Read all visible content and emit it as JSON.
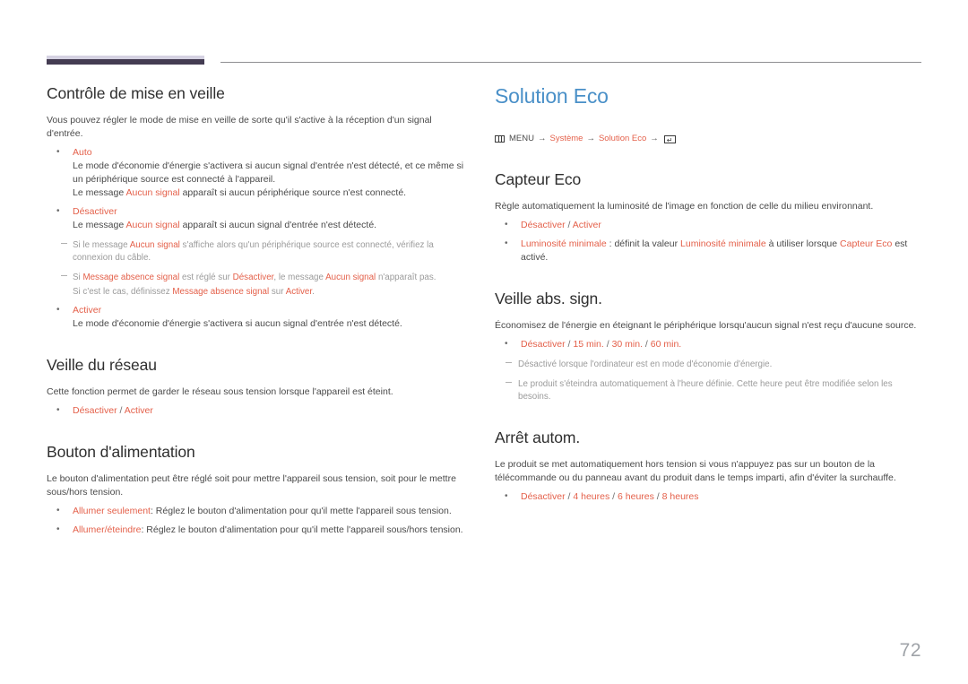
{
  "document": {
    "page_number": "72",
    "accent_color": "#e4604a",
    "title_color": "#4a90c8",
    "rule_color": "#443c52"
  },
  "left_column": {
    "section1": {
      "heading": "Contrôle de mise en veille",
      "intro": "Vous pouvez régler le mode de mise en veille de sorte qu'il s'active à la réception d'un signal d'entrée.",
      "items": [
        {
          "label": "Auto",
          "line1": "Le mode d'économie d'énergie s'activera si aucun signal d'entrée n'est détecté, et ce même si un périphérique source est connecté à l'appareil.",
          "line2_pre": "Le message ",
          "line2_accent": "Aucun signal",
          "line2_post": " apparaît si aucun périphérique source n'est connecté."
        },
        {
          "label": "Désactiver",
          "line1_pre": "Le message ",
          "line1_accent": "Aucun signal",
          "line1_post": " apparaît si aucun signal d'entrée n'est détecté."
        },
        {
          "label": "Activer",
          "line1": "Le mode d'économie d'énergie s'activera si aucun signal d'entrée n'est détecté."
        }
      ],
      "notes": [
        {
          "pre": "Si le message ",
          "accent1": "Aucun signal",
          "post": " s'affiche alors qu'un périphérique source est connecté, vérifiez la connexion du câble."
        },
        {
          "pre": "Si ",
          "accent1": "Message absence signal",
          "mid1": " est réglé sur ",
          "accent2": "Désactiver",
          "mid2": ", le message ",
          "accent3": "Aucun signal",
          "post": " n'apparaît pas.",
          "extra_pre": "Si c'est le cas, définissez ",
          "extra_accent1": "Message absence signal",
          "extra_mid": " sur ",
          "extra_accent2": "Activer",
          "extra_post": "."
        }
      ]
    },
    "section2": {
      "heading": "Veille du réseau",
      "intro": "Cette fonction permet de garder le réseau sous tension lorsque l'appareil est éteint.",
      "option_a": "Désactiver",
      "option_sep": " / ",
      "option_b": "Activer"
    },
    "section3": {
      "heading": "Bouton d'alimentation",
      "intro": "Le bouton d'alimentation peut être réglé soit pour mettre l'appareil sous tension, soit pour le mettre sous/hors tension.",
      "items": [
        {
          "label": "Allumer seulement",
          "text": ": Réglez le bouton d'alimentation pour qu'il mette l'appareil sous tension."
        },
        {
          "label": "Allumer/éteindre",
          "text": ": Réglez le bouton d'alimentation pour qu'il mette l'appareil sous/hors tension."
        }
      ]
    }
  },
  "right_column": {
    "title": "Solution Eco",
    "breadcrumb": {
      "menu_icon": "menu-icon",
      "menu_label": "MENU",
      "arrow": "→",
      "crumb1": "Système",
      "crumb2": "Solution Eco",
      "enter_icon": "enter-key-icon",
      "enter_glyph": "↵"
    },
    "section1": {
      "heading": "Capteur Eco",
      "intro": "Règle automatiquement la luminosité de l'image en fonction de celle du milieu environnant.",
      "bullet1": {
        "option_a": "Désactiver",
        "sep": " / ",
        "option_b": "Activer"
      },
      "bullet2": {
        "accent1": "Luminosité minimale",
        "mid1": " : définit la valeur ",
        "accent2": "Luminosité minimale",
        "mid2": " à utiliser lorsque ",
        "accent3": "Capteur Eco",
        "post": " est activé."
      }
    },
    "section2": {
      "heading": "Veille abs. sign.",
      "intro": "Économisez de l'énergie en éteignant le périphérique lorsqu'aucun signal n'est reçu d'aucune source.",
      "options": [
        "Désactiver",
        "15 min.",
        "30 min.",
        "60 min."
      ],
      "option_sep": " / ",
      "notes": [
        "Désactivé lorsque l'ordinateur est en mode d'économie d'énergie.",
        "Le produit s'éteindra automatiquement à l'heure définie. Cette heure peut être modifiée selon les besoins."
      ]
    },
    "section3": {
      "heading": "Arrêt autom.",
      "intro": "Le produit se met automatiquement hors tension si vous n'appuyez pas sur un bouton de la télécommande ou du panneau avant du produit dans le temps imparti, afin d'éviter la surchauffe.",
      "options": [
        "Désactiver",
        "4 heures",
        "6 heures",
        "8 heures"
      ],
      "option_sep": " / "
    }
  }
}
